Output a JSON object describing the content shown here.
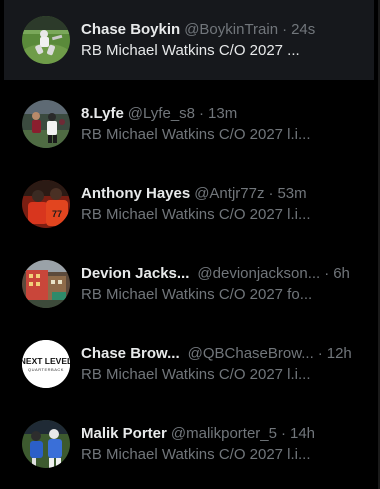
{
  "conversations": [
    {
      "name": "Chase Boykin",
      "handle": "@BoykinTrain",
      "time": "24s",
      "preview": "RB Michael Watkins C/O 2027 ...",
      "unread": true,
      "avatar": "football-field-photo"
    },
    {
      "name": "8.Lyfe",
      "handle": "@Lyfe_s8",
      "time": "13m",
      "preview": "RB Michael Watkins C/O 2027 l.i...",
      "unread": false,
      "avatar": "players-photo"
    },
    {
      "name": "Anthony Hayes",
      "handle": "@Antjr77z",
      "time": "53m",
      "preview": "RB Michael Watkins C/O 2027 l.i...",
      "unread": false,
      "avatar": "red-jersey-photo"
    },
    {
      "name": "Devion Jacks...",
      "handle": "@devionjackson...",
      "time": "6h",
      "preview": "RB Michael Watkins C/O 2027 fo...",
      "unread": false,
      "avatar": "building-photo"
    },
    {
      "name": "Chase Brow...",
      "handle": "@QBChaseBrow...",
      "time": "12h",
      "preview": "RB Michael Watkins C/O 2027 l.i...",
      "unread": false,
      "avatar": "next-level-logo",
      "avatar_text": [
        "NEXT LEVEL",
        "QUARTERBACK"
      ]
    },
    {
      "name": "Malik Porter",
      "handle": "@malikporter_5",
      "time": "14h",
      "preview": "RB Michael Watkins C/O 2027 l.i...",
      "unread": false,
      "avatar": "blue-jersey-photo"
    }
  ],
  "separator": "·",
  "colors": {
    "background": "#000000",
    "active_row": "#16181c",
    "primary_text": "#e7e9ea",
    "secondary_text": "#71767b",
    "border": "#2f3336"
  }
}
